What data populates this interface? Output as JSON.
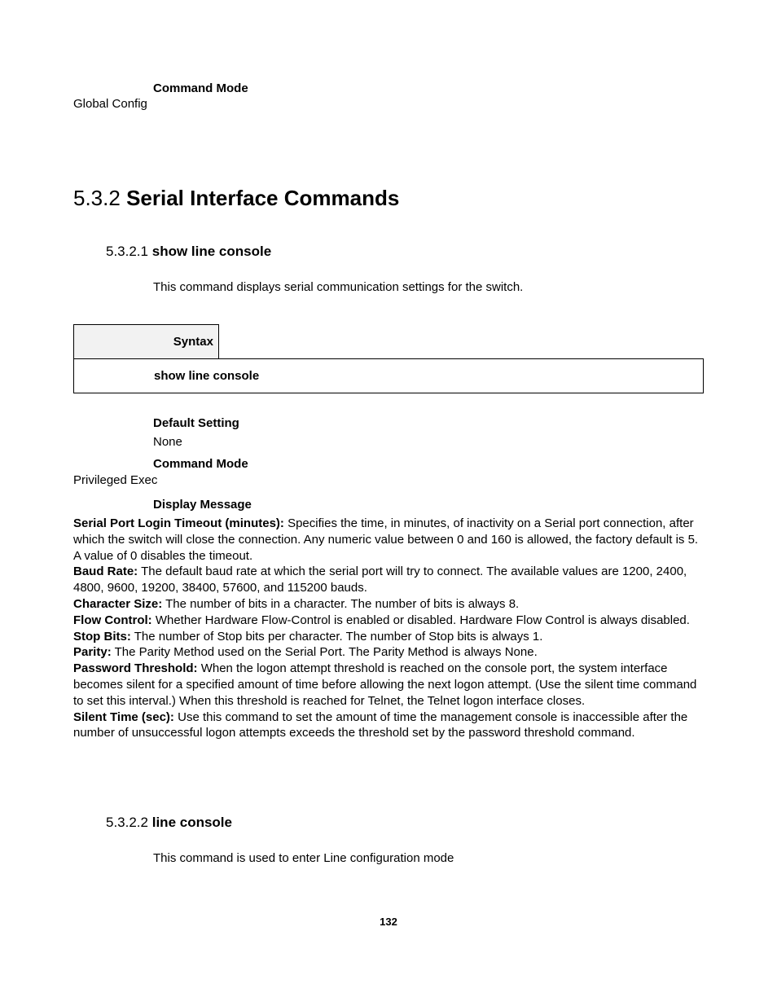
{
  "top": {
    "cmdModeLabel": "Command Mode",
    "cmdModeValue": "Global Config"
  },
  "section": {
    "number": "5.3.2",
    "title": "Serial Interface Commands"
  },
  "sub1": {
    "number": "5.3.2.1",
    "title": "show line console",
    "intro": "This command displays serial communication settings for the switch.",
    "syntaxLabel": "Syntax",
    "syntaxBody": "show line console",
    "defaultLabel": "Default Setting",
    "defaultValue": "None",
    "cmdModeLabel": "Command Mode",
    "cmdModeValue": "Privileged Exec",
    "displayLabel": "Display Message",
    "items": {
      "serialPort": {
        "k": "Serial Port Login Timeout (minutes):",
        "v": " Specifies the time, in minutes, of inactivity on a Serial port connection, after which the switch will close the connection. Any numeric value between 0 and 160 is allowed, the factory default is 5. A value of 0 disables the timeout."
      },
      "baud": {
        "k": "Baud Rate:",
        "v": " The default baud rate at which the serial port will try to connect. The available values are 1200, 2400, 4800, 9600, 19200, 38400, 57600, and 115200 bauds."
      },
      "charSize": {
        "k": "Character Size:",
        "v": " The number of bits in a character. The number of bits is always 8."
      },
      "flow": {
        "k": "Flow Control:",
        "v": " Whether Hardware Flow-Control is enabled or disabled. Hardware Flow Control is always disabled."
      },
      "stop": {
        "k": "Stop Bits:",
        "v": " The number of Stop bits per character. The number of Stop bits is always 1."
      },
      "parity": {
        "k": "Parity:",
        "v": " The Parity Method used on the Serial Port. The Parity Method is always None."
      },
      "pwd": {
        "k": "Password Threshold:",
        "v": " When the logon attempt threshold is reached on the console port, the system interface becomes silent for a specified amount of time before allowing the next logon attempt. (Use the silent time command to set this interval.) When this threshold is reached for Telnet, the Telnet logon interface closes."
      },
      "silent": {
        "k": "Silent Time (sec):",
        "v": " Use this command to set the amount of time the management console is inaccessible after the number of unsuccessful logon attempts exceeds the threshold set by the password threshold command."
      }
    }
  },
  "sub2": {
    "number": "5.3.2.2",
    "title": "line console",
    "intro": "This command is used to enter Line configuration mode"
  },
  "pageNumber": "132"
}
